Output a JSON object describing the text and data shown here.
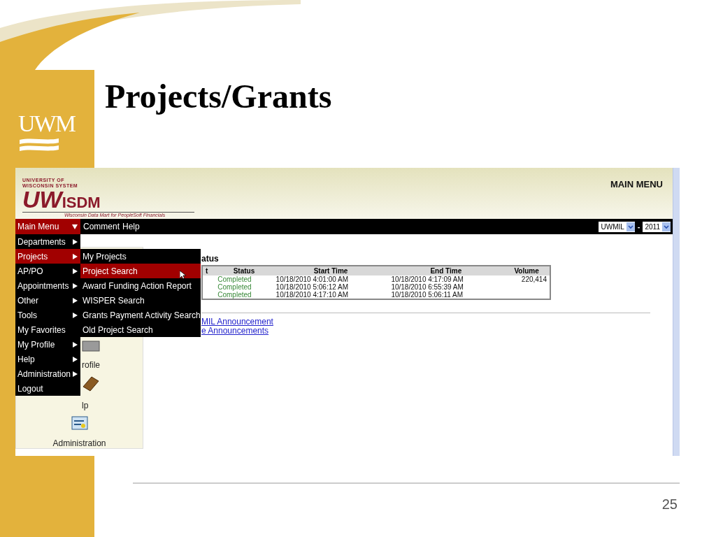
{
  "slide": {
    "title": "Projects/Grants",
    "logo": "UWM",
    "page_number": "25"
  },
  "app": {
    "logo_caption": [
      "UNIVERSITY OF",
      "WISCONSIN SYSTEM"
    ],
    "logo_mark": "UW",
    "logo_name": "ISDM",
    "logo_tagline": "Wisconsin Data Mart for PeopleSoft Financials",
    "page_heading": "MAIN MENU",
    "nav": {
      "main_menu": "Main Menu",
      "links": [
        "Comment",
        "Help"
      ],
      "selects": [
        {
          "value": "UWMIL"
        },
        {
          "value": "2011"
        }
      ],
      "separator": "-"
    },
    "menu": [
      {
        "label": "Departments",
        "selected": false,
        "submenu": true
      },
      {
        "label": "Projects",
        "selected": true,
        "submenu": true
      },
      {
        "label": "AP/PO",
        "selected": false,
        "submenu": true
      },
      {
        "label": "Appointments",
        "selected": false,
        "submenu": true
      },
      {
        "label": "Other",
        "selected": false,
        "submenu": true
      },
      {
        "label": "Tools",
        "selected": false,
        "submenu": true
      },
      {
        "label": "My Favorites",
        "selected": false,
        "submenu": false
      },
      {
        "label": "My Profile",
        "selected": false,
        "submenu": true
      },
      {
        "label": "Help",
        "selected": false,
        "submenu": true
      },
      {
        "label": "Administration",
        "selected": false,
        "submenu": true
      },
      {
        "label": "Logout",
        "selected": false,
        "submenu": false
      }
    ],
    "submenu": [
      {
        "label": "My Projects",
        "selected": false
      },
      {
        "label": "Project Search",
        "selected": true
      },
      {
        "label": "Award Funding Action Report",
        "selected": false
      },
      {
        "label": "WISPER Search",
        "selected": false
      },
      {
        "label": "Grants Payment Activity Search",
        "selected": false
      },
      {
        "label": "Old Project Search",
        "selected": false
      }
    ],
    "sidebar": [
      {
        "kind": "profile",
        "label": "rofile"
      },
      {
        "kind": "help",
        "label": "lp"
      },
      {
        "kind": "admin",
        "label": "Administration"
      }
    ],
    "table": {
      "title": "atus",
      "columns": [
        "t",
        "Status",
        "Start Time",
        "End Time",
        "Volume"
      ],
      "rows": [
        [
          "",
          "Completed",
          "10/18/2010 4:01:00 AM",
          "10/18/2010 4:17:09 AM",
          "220,414"
        ],
        [
          "",
          "Completed",
          "10/18/2010 5:06:12 AM",
          "10/18/2010 6:55:39 AM",
          ""
        ],
        [
          "",
          "Completed",
          "10/18/2010 4:17:10 AM",
          "10/18/2010 5:06:11 AM",
          ""
        ]
      ]
    },
    "links": [
      "MIL Announcement",
      "e Announcements"
    ]
  }
}
